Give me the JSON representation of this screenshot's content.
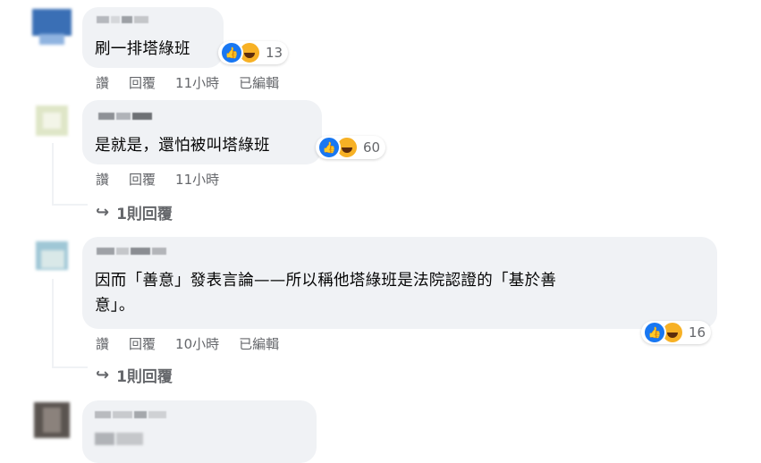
{
  "comments": [
    {
      "text": "刷一排塔綠班",
      "reaction_count": "13",
      "actions": {
        "like": "讚",
        "reply": "回覆",
        "time": "11小時",
        "edited": "已編輯"
      }
    },
    {
      "text": "是就是，還怕被叫塔綠班",
      "reaction_count": "60",
      "actions": {
        "like": "讚",
        "reply": "回覆",
        "time": "11小時"
      },
      "replies_label": "1則回覆"
    },
    {
      "text_line1": "因而「善意」發表言論——所以稱他塔綠班是法院認證的「基於善",
      "text_line2": "意」。",
      "reaction_count": "16",
      "actions": {
        "like": "讚",
        "reply": "回覆",
        "time": "10小時",
        "edited": "已編輯"
      },
      "replies_label": "1則回覆"
    }
  ],
  "icons": {
    "reply_arrow": "reply-arrow-icon",
    "like": "like-reaction-icon",
    "haha": "haha-reaction-icon"
  },
  "colors": {
    "bubble": "#f0f2f5",
    "like": "#1877f2",
    "haha": "#f7b125",
    "meta": "#65676b"
  }
}
